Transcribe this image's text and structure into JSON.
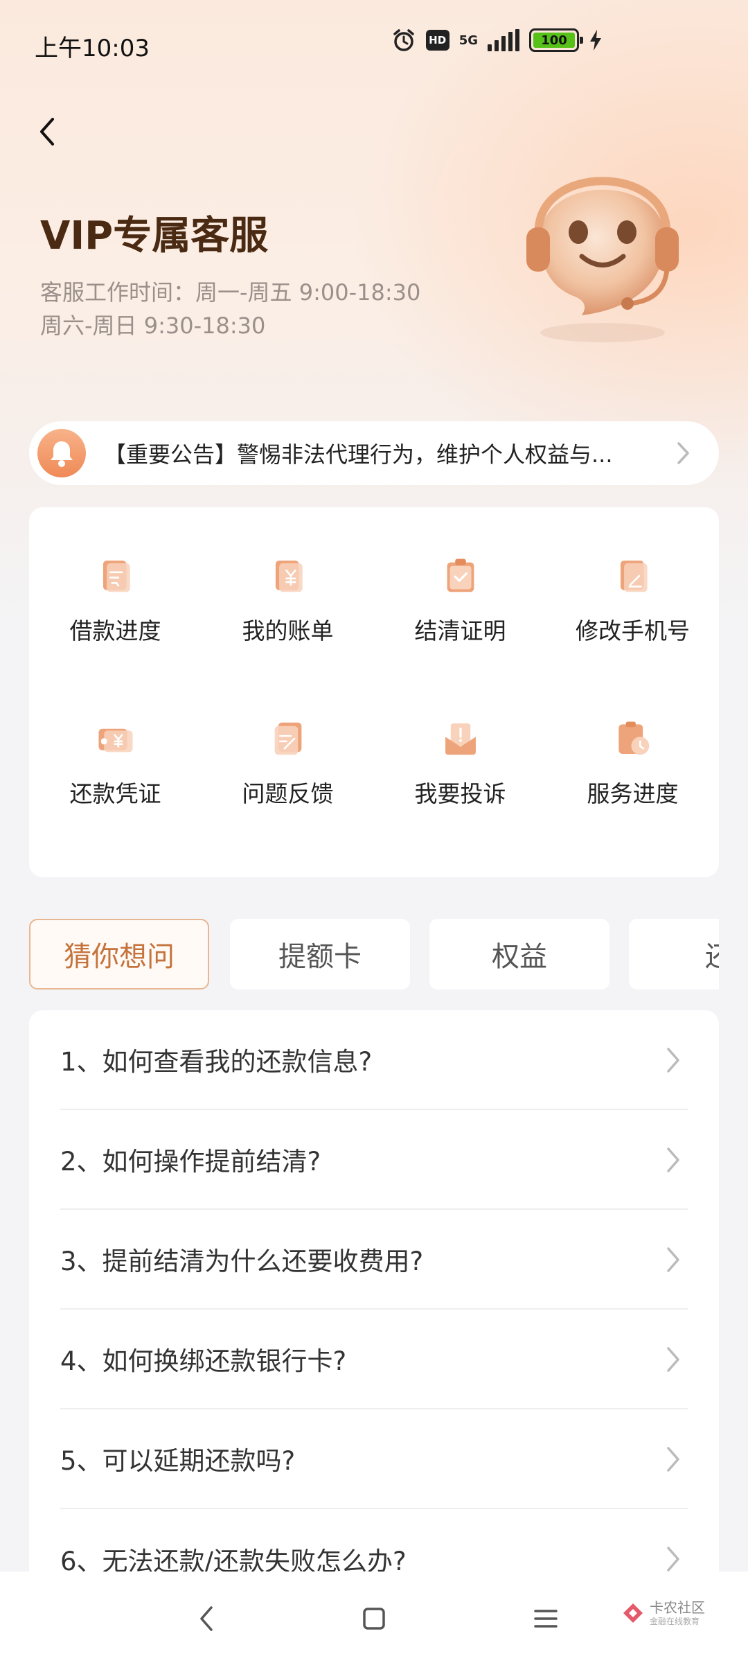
{
  "status_bar": {
    "time": "上午10:03",
    "hd_label": "HD",
    "network": "5G",
    "battery": "100"
  },
  "header": {
    "title": "VIP专属客服",
    "hours_line1": "客服工作时间：周一-周五 9:00-18:30",
    "hours_line2": "周六-周日 9:30-18:30"
  },
  "notice": {
    "text": "【重要公告】警惕非法代理行为，维护个人权益与..."
  },
  "services": [
    {
      "label": "借款进度",
      "icon": "loan-progress-icon"
    },
    {
      "label": "我的账单",
      "icon": "bill-icon"
    },
    {
      "label": "结清证明",
      "icon": "settlement-certificate-icon"
    },
    {
      "label": "修改手机号",
      "icon": "edit-phone-icon"
    },
    {
      "label": "还款凭证",
      "icon": "repayment-voucher-icon"
    },
    {
      "label": "问题反馈",
      "icon": "feedback-icon"
    },
    {
      "label": "我要投诉",
      "icon": "complaint-icon"
    },
    {
      "label": "服务进度",
      "icon": "service-progress-icon"
    }
  ],
  "tabs": [
    {
      "label": "猜你想问",
      "active": true
    },
    {
      "label": "提额卡",
      "active": false
    },
    {
      "label": "权益",
      "active": false
    },
    {
      "label": "还",
      "active": false
    }
  ],
  "faq": [
    "1、如何查看我的还款信息?",
    "2、如何操作提前结清?",
    "3、提前结清为什么还要收费用?",
    "4、如何换绑还款银行卡?",
    "5、可以延期还款吗?",
    "6、无法还款/还款失败怎么办?"
  ],
  "watermark": {
    "main": "卡农社区",
    "sub": "金融在线教育"
  },
  "colors": {
    "accent": "#ef8a57",
    "title": "#4a2a12",
    "active_tab": "#c5733c"
  }
}
